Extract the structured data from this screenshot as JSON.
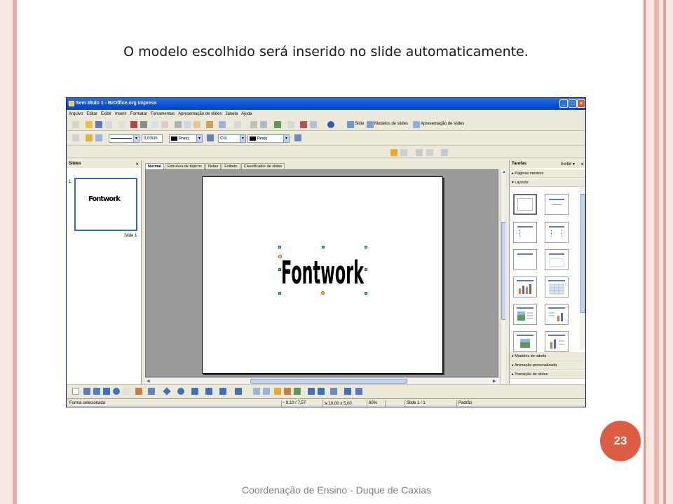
{
  "slide": {
    "title": "O modelo escolhido será inserido no slide automaticamente.",
    "page_number": "23",
    "footer": "Coordenação de Ensino - Duque de Caxias"
  },
  "app": {
    "window_title": "Sem título 1 - BrOffice.org Impress",
    "menu": [
      "Arquivo",
      "Editar",
      "Exibir",
      "Inserir",
      "Formatar",
      "Ferramentas",
      "Apresentação de slides",
      "Janela",
      "Ajuda"
    ],
    "toolbar": {
      "slide_label": "Slide",
      "templates_label": "Modelos de slides",
      "presentation_label": "Apresentação de slides",
      "line_width": "0,03cm",
      "line_color": "Preto",
      "area_style": "Cor",
      "area_color": "Preto"
    },
    "slides_pane": {
      "title": "Slides",
      "slide_number": "1",
      "slide_label": "Slide 1",
      "thumb_text": "Fontwork"
    },
    "view_tabs": [
      "Normal",
      "Estrutura de tópicos",
      "Notas",
      "Folheto",
      "Classificador de slides"
    ],
    "canvas": {
      "fontwork_text": "Fontwork"
    },
    "tasks_pane": {
      "title": "Tarefas",
      "view_label": "Exibir",
      "sections_top": [
        "Páginas mestres",
        "Layouts"
      ],
      "sections_bottom": [
        "Modelos de tabela",
        "Animação personalizada",
        "Transição de slides"
      ]
    },
    "status": {
      "message": "Forma selecionada",
      "position": "9,10 / 7,57",
      "size": "10,00 x 5,00",
      "zoom": "60%",
      "slide": "Slide 1 / 1",
      "master": "Padrão"
    }
  },
  "colors": {
    "accent_circle": "#dd5c43",
    "frame_rose": "#e5aaa3",
    "xp_title_blue": "#0a4fd0"
  }
}
